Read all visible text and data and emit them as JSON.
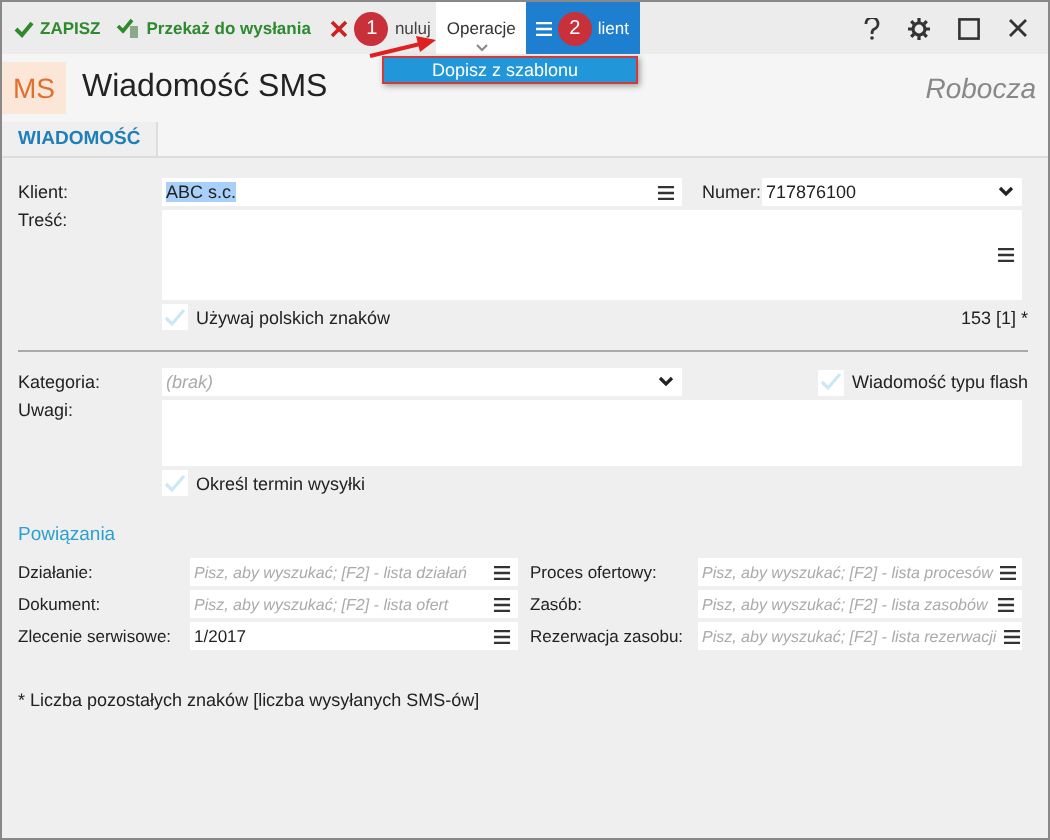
{
  "toolbar": {
    "actions": [
      {
        "kind": "save",
        "label": "ZAPISZ"
      },
      {
        "kind": "forward",
        "label": "Przekaż do wysłania"
      },
      {
        "kind": "cancel",
        "label": "nuluj"
      }
    ],
    "menus": [
      {
        "label": "Operacje",
        "expanded": true,
        "highlighted": false,
        "kind": "dropdown"
      },
      {
        "label": "lient",
        "expanded": false,
        "highlighted": true,
        "kind": "list"
      }
    ],
    "open_menu": {
      "items": [
        "Dopisz z szablonu"
      ]
    }
  },
  "callouts": [
    {
      "number": "1"
    },
    {
      "number": "2"
    }
  ],
  "header": {
    "avatar": "MS",
    "title": "Wiadomość SMS",
    "status": "Robocza"
  },
  "tabs": [
    {
      "label": "WIADOMOŚĆ",
      "selected": true
    }
  ],
  "form": {
    "client": {
      "label": "Klient:",
      "value": "ABC s.c.",
      "selected_text": true
    },
    "number": {
      "label": "Numer:",
      "value": "717876100"
    },
    "content": {
      "label": "Treść:"
    },
    "polish_chars": {
      "label": "Używaj polskich znaków",
      "checked": false
    },
    "counter": "153 [1] *",
    "category": {
      "label": "Kategoria:",
      "placeholder": "(brak)"
    },
    "flash": {
      "label": "Wiadomość typu flash",
      "checked": false
    },
    "notes": {
      "label": "Uwagi:"
    },
    "schedule": {
      "label": "Określ termin wysyłki",
      "checked": false
    }
  },
  "relations": {
    "title": "Powiązania",
    "fields": [
      {
        "label": "Działanie:",
        "placeholder": "Pisz, aby wyszukać; [F2] - lista działań"
      },
      {
        "label": "Proces ofertowy:",
        "placeholder": "Pisz, aby wyszukać; [F2] - lista procesów"
      },
      {
        "label": "Dokument:",
        "placeholder": "Pisz, aby wyszukać; [F2] - lista ofert"
      },
      {
        "label": "Zasób:",
        "placeholder": "Pisz, aby wyszukać; [F2] - lista zasobów"
      },
      {
        "label": "Zlecenie serwisowe:",
        "value": "1/2017"
      },
      {
        "label": "Rezerwacja zasobu:",
        "placeholder": "Pisz, aby wyszukać; [F2] - lista rezerwacji"
      }
    ]
  },
  "footnote": "* Liczba pozostałych znaków [liczba wysyłanych SMS-ów]"
}
